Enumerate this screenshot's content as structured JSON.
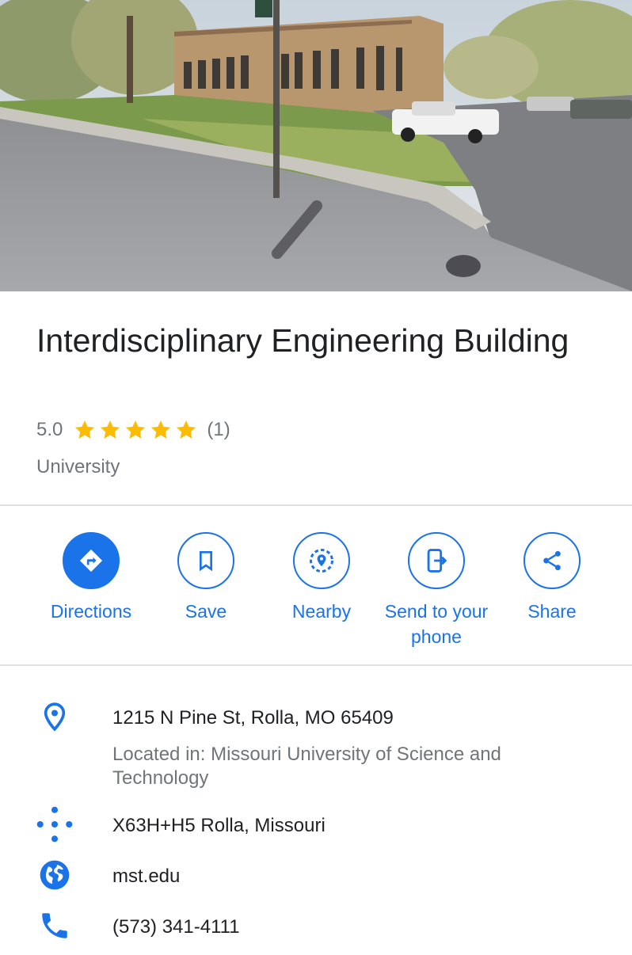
{
  "place": {
    "title": "Interdisciplinary Engineering Building",
    "rating": "5.0",
    "star_count": 5,
    "review_count": "(1)",
    "category": "University",
    "hero_image_icon": "street-view-photo"
  },
  "actions": [
    {
      "label": "Directions",
      "icon": "directions-icon"
    },
    {
      "label": "Save",
      "icon": "bookmark-icon"
    },
    {
      "label": "Nearby",
      "icon": "nearby-icon"
    },
    {
      "label": "Send to your phone",
      "icon": "send-to-phone-icon"
    },
    {
      "label": "Share",
      "icon": "share-icon"
    }
  ],
  "info": {
    "address": "1215 N Pine St, Rolla, MO 65409",
    "located_in": "Located in: Missouri University of Science and Technology",
    "plus_code": "X63H+H5 Rolla, Missouri",
    "website": "mst.edu",
    "phone": "(573) 341-4111"
  },
  "colors": {
    "accent": "#1a73e8",
    "star": "#fbbc04",
    "secondary_text": "#70757a"
  }
}
